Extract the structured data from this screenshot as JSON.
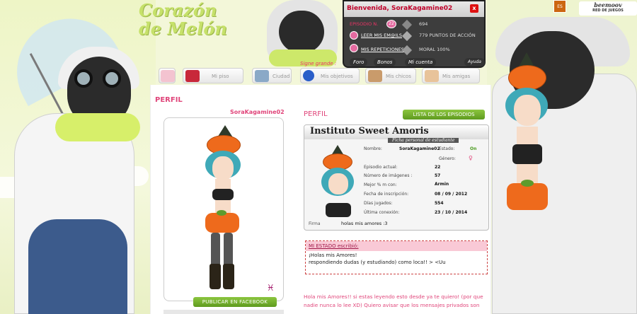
{
  "header": {
    "logo_text": "Corazón de Melón",
    "welcome": "Bienvenida, SoraKagamine02",
    "close": "x",
    "episode_label": "EPISODIO N.",
    "episode_num": "22",
    "gems": "694",
    "read_emails": "LEER MIS EM@ILS",
    "action_points": "779 PUNTOS DE ACCIÓN",
    "repetitions": "MIS REPETICIONES",
    "moral": "MORAL 100%",
    "lang": "ES",
    "network_brand": "beemoov",
    "network_sub": "RED DE JUEGOS"
  },
  "nav": {
    "signed": "Signe grande :",
    "pills": [
      "Foro",
      "Bonos",
      "Mi cuenta",
      "Ayuda"
    ],
    "items": [
      {
        "label": "",
        "icon": "home-icon"
      },
      {
        "label": "Mi piso",
        "icon": "sofa-icon"
      },
      {
        "label": "Ciudad",
        "icon": "city-icon"
      },
      {
        "label": "Mis objetivos",
        "icon": "target-icon"
      },
      {
        "label": "Mis chicos",
        "icon": "boy-icon"
      },
      {
        "label": "Mis amigas",
        "icon": "girl-icon"
      }
    ]
  },
  "profile": {
    "heading": "PERFIL",
    "username": "SoraKagamine02",
    "zodiac": "♓",
    "facebook_btn": "PUBLICAR EN FACEBOOK",
    "section_title": "PERFIL",
    "episodes_btn": "LISTA DE LOS EPISODIOS",
    "card_title": "Instituto Sweet Amoris",
    "card_sub": "Ficha personal de estudiante",
    "fields": [
      {
        "label": "Nombre:",
        "value": "SoraKagamine02"
      },
      {
        "label": "Estado:",
        "value": "On"
      },
      {
        "label": "Género:",
        "value": "♀"
      },
      {
        "label": "Episodio actual:",
        "value": "22"
      },
      {
        "label": "Número de imágenes :",
        "value": "57"
      },
      {
        "label": "Mejor % m con:",
        "value": "Armin"
      },
      {
        "label": "Fecha de inscripción:",
        "value": "08 / 09 / 2012"
      },
      {
        "label": "Días jugados:",
        "value": "554"
      },
      {
        "label": "Última conexión:",
        "value": "23 / 10 / 2014"
      }
    ],
    "sign_label": "Firma",
    "sign_value": "holas mis amores :3",
    "status_head": "MI ESTADO escribió:",
    "status_lines": [
      "¡Holas mis Amores!",
      "respondiendo dudas (y estudiando) como loca!! > <Uu"
    ],
    "bio": "Hola mis Amores!! si estas leyendo esto desde ya te quiero! (por que nadie nunca lo lee XD) Quiero avisar que los mensajes privados son"
  },
  "colors": {
    "accent": "#e0457a",
    "green": "#6aa82a",
    "bg": "#f3f7d9"
  }
}
